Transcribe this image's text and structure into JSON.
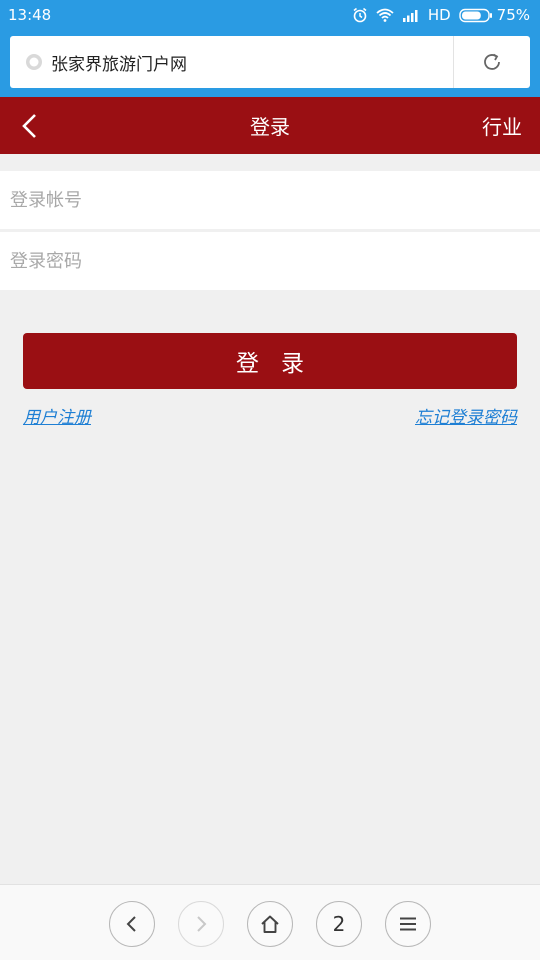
{
  "status_bar": {
    "time": "13:48",
    "network": "HD",
    "battery_percent": "75%",
    "battery_level": 0.75
  },
  "browser": {
    "page_title": "张家界旅游门户网",
    "tab_count": "2"
  },
  "header": {
    "title": "登录",
    "right_label": "行业"
  },
  "form": {
    "account_placeholder": "登录帐号",
    "password_placeholder": "登录密码",
    "login_label": "登录",
    "register_link": "用户注册",
    "forgot_link": "忘记登录密码"
  },
  "colors": {
    "status_bar": "#2a9be3",
    "brand_red": "#9a0f13",
    "link_blue": "#1e7fd4",
    "background": "#f0f0f0"
  },
  "icons": [
    "alarm-icon",
    "wifi-icon",
    "signal-icon",
    "battery-icon",
    "globe-icon",
    "reload-icon",
    "back-arrow-icon",
    "nav-back-icon",
    "nav-forward-icon",
    "home-icon",
    "menu-icon"
  ]
}
